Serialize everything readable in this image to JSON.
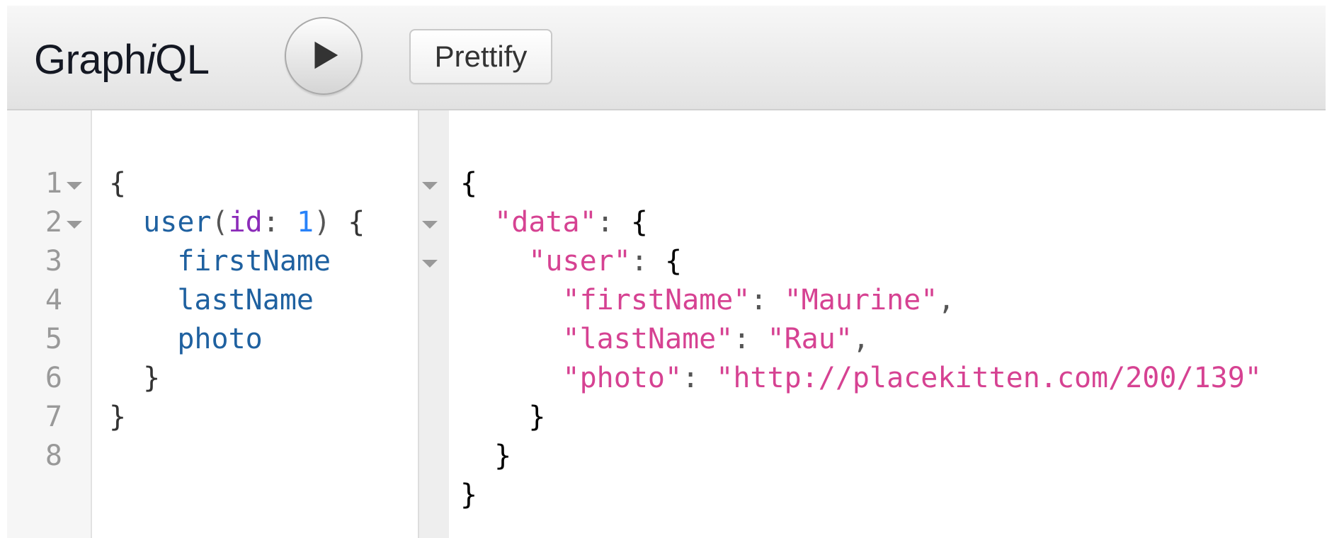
{
  "toolbar": {
    "title_prefix": "Graph",
    "title_italic": "i",
    "title_suffix": "QL",
    "run_icon": "play-icon",
    "prettify_label": "Prettify"
  },
  "query_editor": {
    "line_numbers": [
      "1",
      "2",
      "3",
      "4",
      "5",
      "6",
      "7",
      "8"
    ],
    "folded_lines": [
      "1",
      "2"
    ],
    "lines": [
      {
        "tokens": [
          {
            "t": "{",
            "k": "brace"
          }
        ]
      },
      {
        "tokens": [
          {
            "t": "  ",
            "k": "ws"
          },
          {
            "t": "user",
            "k": "field"
          },
          {
            "t": "(",
            "k": "punct"
          },
          {
            "t": "id",
            "k": "arg"
          },
          {
            "t": ": ",
            "k": "punct"
          },
          {
            "t": "1",
            "k": "num"
          },
          {
            "t": ") ",
            "k": "punct"
          },
          {
            "t": "{",
            "k": "brace"
          }
        ]
      },
      {
        "tokens": [
          {
            "t": "    ",
            "k": "ws"
          },
          {
            "t": "firstName",
            "k": "field"
          }
        ]
      },
      {
        "tokens": [
          {
            "t": "    ",
            "k": "ws"
          },
          {
            "t": "lastName",
            "k": "field"
          }
        ]
      },
      {
        "tokens": [
          {
            "t": "    ",
            "k": "ws"
          },
          {
            "t": "photo",
            "k": "field"
          }
        ]
      },
      {
        "tokens": [
          {
            "t": "  ",
            "k": "ws"
          },
          {
            "t": "}",
            "k": "brace"
          }
        ]
      },
      {
        "tokens": [
          {
            "t": "}",
            "k": "brace"
          }
        ]
      },
      {
        "tokens": []
      }
    ]
  },
  "result_viewer": {
    "fold_rows": [
      true,
      true,
      true,
      false,
      false,
      false,
      false,
      false,
      false
    ],
    "lines": [
      {
        "tokens": [
          {
            "t": "{",
            "k": "res-brace"
          }
        ]
      },
      {
        "tokens": [
          {
            "t": "  ",
            "k": "ws"
          },
          {
            "t": "\"data\"",
            "k": "str"
          },
          {
            "t": ": ",
            "k": "res-punct"
          },
          {
            "t": "{",
            "k": "res-brace"
          }
        ]
      },
      {
        "tokens": [
          {
            "t": "    ",
            "k": "ws"
          },
          {
            "t": "\"user\"",
            "k": "str"
          },
          {
            "t": ": ",
            "k": "res-punct"
          },
          {
            "t": "{",
            "k": "res-brace"
          }
        ]
      },
      {
        "tokens": [
          {
            "t": "      ",
            "k": "ws"
          },
          {
            "t": "\"firstName\"",
            "k": "str"
          },
          {
            "t": ": ",
            "k": "res-punct"
          },
          {
            "t": "\"Maurine\"",
            "k": "str"
          },
          {
            "t": ",",
            "k": "res-punct"
          }
        ]
      },
      {
        "tokens": [
          {
            "t": "      ",
            "k": "ws"
          },
          {
            "t": "\"lastName\"",
            "k": "str"
          },
          {
            "t": ": ",
            "k": "res-punct"
          },
          {
            "t": "\"Rau\"",
            "k": "str"
          },
          {
            "t": ",",
            "k": "res-punct"
          }
        ]
      },
      {
        "tokens": [
          {
            "t": "      ",
            "k": "ws"
          },
          {
            "t": "\"photo\"",
            "k": "str"
          },
          {
            "t": ": ",
            "k": "res-punct"
          },
          {
            "t": "\"http://placekitten.com/200/139\"",
            "k": "str"
          }
        ]
      },
      {
        "tokens": [
          {
            "t": "    ",
            "k": "ws"
          },
          {
            "t": "}",
            "k": "res-brace"
          }
        ]
      },
      {
        "tokens": [
          {
            "t": "  ",
            "k": "ws"
          },
          {
            "t": "}",
            "k": "res-brace"
          }
        ]
      },
      {
        "tokens": [
          {
            "t": "}",
            "k": "res-brace"
          }
        ]
      }
    ]
  },
  "colors": {
    "field": "#1f61a0",
    "argument": "#8b2bb9",
    "number": "#2882f9",
    "string": "#d64292",
    "line_number": "#999999"
  }
}
